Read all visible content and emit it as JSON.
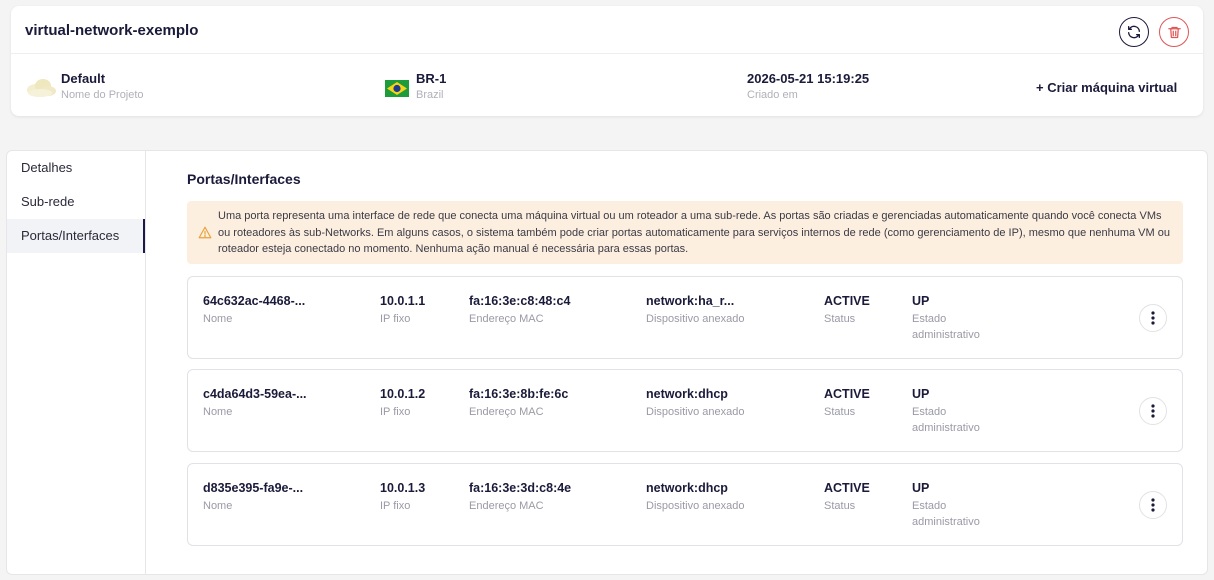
{
  "header": {
    "title": "virtual-network-exemplo",
    "project": {
      "value": "Default",
      "label": "Nome do Projeto"
    },
    "region": {
      "value": "BR-1",
      "label": "Brazil"
    },
    "created": {
      "value": "2026-05-21 15:19:25",
      "label": "Criado em"
    },
    "create_vm_label": "+ Criar máquina virtual"
  },
  "sidebar": {
    "items": [
      {
        "label": "Detalhes",
        "active": false
      },
      {
        "label": "Sub-rede",
        "active": false
      },
      {
        "label": "Portas/Interfaces",
        "active": true
      }
    ]
  },
  "main": {
    "title": "Portas/Interfaces",
    "alert": "Uma porta representa uma interface de rede que conecta uma máquina virtual ou um roteador a uma sub-rede. As portas são criadas e gerenciadas automaticamente quando você conecta VMs ou roteadores às sub-Networks. Em alguns casos, o sistema também pode criar portas automaticamente para serviços internos de rede (como gerenciamento de IP), mesmo que nenhuma VM ou roteador esteja conectado no momento. Nenhuma ação manual é necessária para essas portas."
  },
  "port_labels": {
    "name": "Nome",
    "ip": "IP fixo",
    "mac": "Endereço MAC",
    "device": "Dispositivo anexado",
    "status": "Status",
    "admin": "Estado administrativo"
  },
  "ports": [
    {
      "name": "64c632ac-4468-...",
      "ip": "10.0.1.1",
      "mac": "fa:16:3e:c8:48:c4",
      "device": "network:ha_r...",
      "status": "ACTIVE",
      "admin": "UP"
    },
    {
      "name": "c4da64d3-59ea-...",
      "ip": "10.0.1.2",
      "mac": "fa:16:3e:8b:fe:6c",
      "device": "network:dhcp",
      "status": "ACTIVE",
      "admin": "UP"
    },
    {
      "name": "d835e395-fa9e-...",
      "ip": "10.0.1.3",
      "mac": "fa:16:3e:3d:c8:4e",
      "device": "network:dhcp",
      "status": "ACTIVE",
      "admin": "UP"
    }
  ],
  "colors": {
    "primary": "#1a1a3a",
    "danger": "#e05555",
    "alert_bg": "#fdefe0",
    "alert_icon": "#e8a13a"
  },
  "icons": {
    "refresh": "refresh-icon",
    "delete": "trash-icon",
    "project": "cloud-icon",
    "region": "brazil-flag-icon",
    "alert": "warning-icon",
    "row_actions": "more-vertical-icon"
  }
}
